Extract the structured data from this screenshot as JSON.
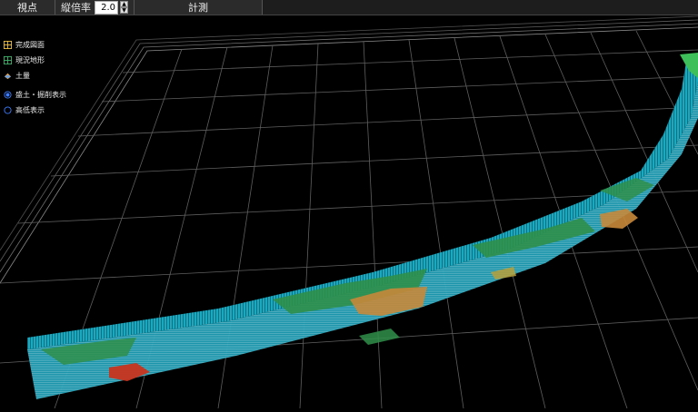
{
  "toolbar": {
    "view_label": "視点",
    "zoom_label": "縦倍率",
    "zoom_value": "2.0",
    "measure_label": "計測"
  },
  "panel": {
    "items": [
      {
        "label": "完成図面",
        "icon": "grid-yellow-icon"
      },
      {
        "label": "現況地形",
        "icon": "grid-green-icon"
      },
      {
        "label": "土量",
        "icon": "earth-volume-icon"
      }
    ],
    "radios": [
      {
        "label": "盛土・掘削表示",
        "selected": true
      },
      {
        "label": "高低表示",
        "selected": false
      }
    ]
  },
  "colors": {
    "background": "#000000",
    "toolbar": "#2b2b2b",
    "grid": "#5f5f5f",
    "cyan": "#19b4c8",
    "green": "#2f8f4a",
    "orange": "#c7883a",
    "red": "#c8341e",
    "radio": "#3d7dff"
  }
}
